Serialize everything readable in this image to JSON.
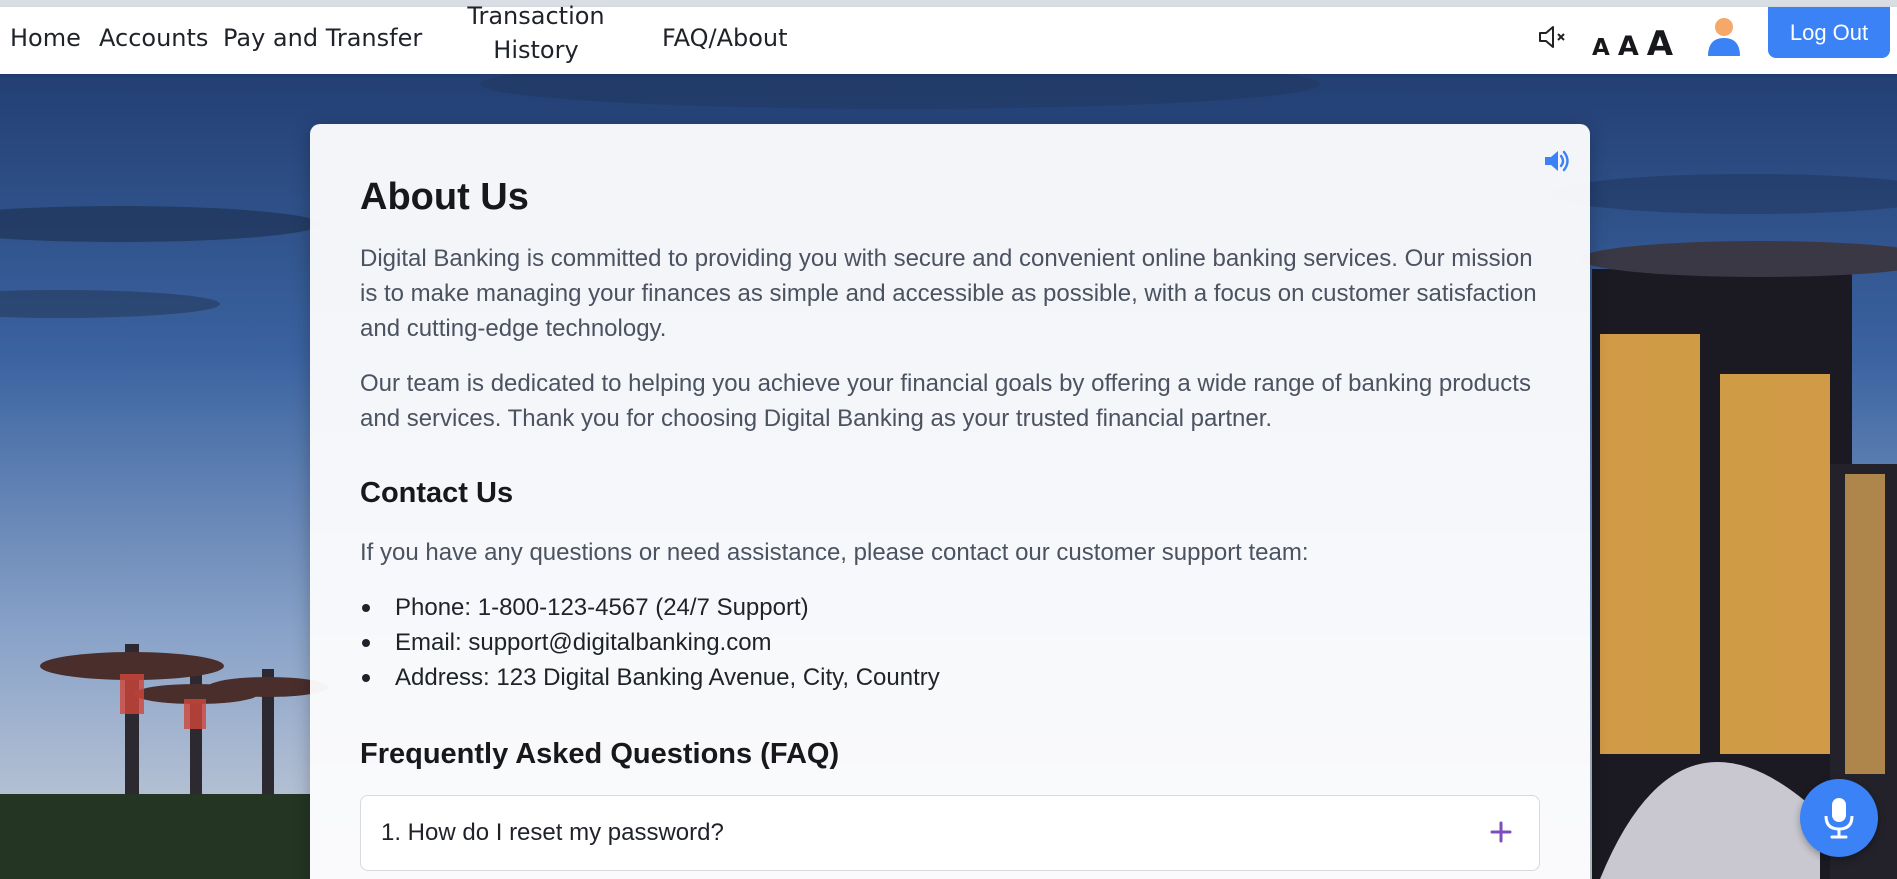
{
  "nav": {
    "home": "Home",
    "accounts": "Accounts",
    "pay_transfer": "Pay and Transfer",
    "transaction_history": "Transaction History",
    "faq_about": "FAQ/About"
  },
  "toolbar": {
    "mute_icon": "speaker-muted-icon",
    "font_small": "A",
    "font_medium": "A",
    "font_large": "A",
    "avatar_icon": "user-avatar-icon",
    "logout_label": "Log Out"
  },
  "about": {
    "title": "About Us",
    "paragraph1": "Digital Banking is committed to providing you with secure and convenient online banking services. Our mission is to make managing your finances as simple and accessible as possible, with a focus on customer satisfaction and cutting-edge technology.",
    "paragraph2": "Our team is dedicated to helping you achieve your financial goals by offering a wide range of banking products and services. Thank you for choosing Digital Banking as your trusted financial partner.",
    "speaker_icon": "speaker-volume-icon"
  },
  "contact": {
    "title": "Contact Us",
    "intro": "If you have any questions or need assistance, please contact our customer support team:",
    "items": [
      "Phone: 1-800-123-4567 (24/7 Support)",
      "Email: support@digitalbanking.com",
      "Address: 123 Digital Banking Avenue, City, Country"
    ]
  },
  "faq": {
    "title": "Frequently Asked Questions (FAQ)",
    "items": [
      {
        "question": "1. How do I reset my password?",
        "expand_icon": "plus-icon"
      }
    ]
  },
  "colors": {
    "accent": "#3b82f6",
    "plus": "#7c4dbe",
    "text_dark": "#16181c",
    "text_muted": "#4b5260"
  },
  "voice": {
    "mic_icon": "microphone-icon"
  }
}
